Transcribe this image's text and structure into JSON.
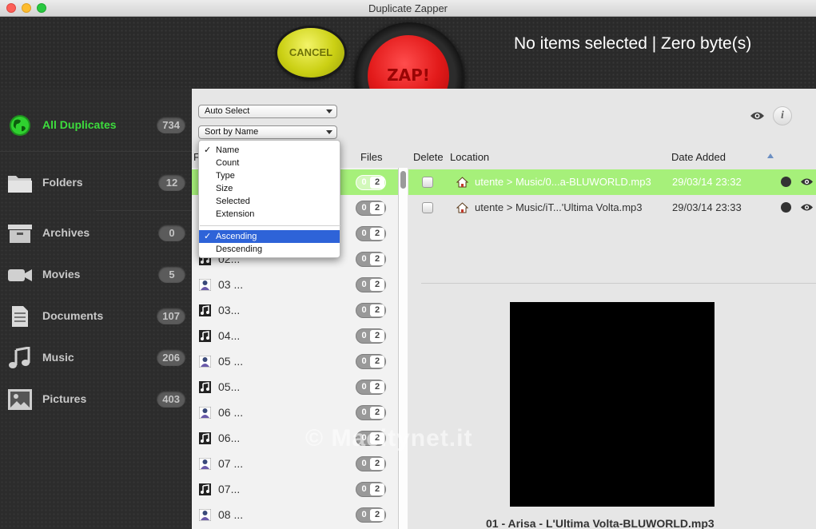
{
  "window": {
    "title": "Duplicate Zapper"
  },
  "toolbar": {
    "cancel_label": "CANCEL",
    "zap_label": "ZAP!",
    "status_text": "No items selected | Zero byte(s)"
  },
  "sidebar": {
    "items": [
      {
        "label": "All Duplicates",
        "count": "734",
        "icon": "globe-icon",
        "active": true
      },
      {
        "label": "Folders",
        "count": "12",
        "icon": "folder-icon"
      },
      {
        "label": "Archives",
        "count": "0",
        "icon": "archive-box-icon"
      },
      {
        "label": "Movies",
        "count": "5",
        "icon": "video-camera-icon"
      },
      {
        "label": "Documents",
        "count": "107",
        "icon": "document-icon"
      },
      {
        "label": "Music",
        "count": "206",
        "icon": "music-note-icon"
      },
      {
        "label": "Pictures",
        "count": "403",
        "icon": "picture-icon"
      }
    ]
  },
  "controls": {
    "auto_select": "Auto Select",
    "sort_by": "Sort by Name"
  },
  "sort_menu": {
    "fields": [
      "Name",
      "Count",
      "Type",
      "Size",
      "Selected",
      "Extension"
    ],
    "selected_field": "Name",
    "orders": [
      "Ascending",
      "Descending"
    ],
    "selected_order": "Ascending",
    "check_mark": "✓"
  },
  "columns": {
    "file_prefix": "F",
    "files": "Files",
    "delete": "Delete",
    "location": "Location",
    "date_added": "Date Added"
  },
  "file_list": {
    "rows": [
      {
        "name": "",
        "icon": "music-file-icon",
        "sel": "0",
        "total": "2",
        "selected": true
      },
      {
        "name": "",
        "icon": "music-file-icon",
        "sel": "0",
        "total": "2"
      },
      {
        "name": "",
        "icon": "music-file-icon",
        "sel": "0",
        "total": "2"
      },
      {
        "name": "02...",
        "icon": "music-file-icon",
        "sel": "0",
        "total": "2"
      },
      {
        "name": "03 ...",
        "icon": "person-file-icon",
        "sel": "0",
        "total": "2"
      },
      {
        "name": "03...",
        "icon": "music-file-icon",
        "sel": "0",
        "total": "2"
      },
      {
        "name": "04...",
        "icon": "music-file-icon",
        "sel": "0",
        "total": "2"
      },
      {
        "name": "05 ...",
        "icon": "person-file-icon",
        "sel": "0",
        "total": "2"
      },
      {
        "name": "05...",
        "icon": "music-file-icon",
        "sel": "0",
        "total": "2"
      },
      {
        "name": "06 ...",
        "icon": "person-file-icon",
        "sel": "0",
        "total": "2"
      },
      {
        "name": "06...",
        "icon": "music-file-icon",
        "sel": "0",
        "total": "2"
      },
      {
        "name": "07 ...",
        "icon": "person-file-icon",
        "sel": "0",
        "total": "2"
      },
      {
        "name": "07...",
        "icon": "music-file-icon",
        "sel": "0",
        "total": "2"
      },
      {
        "name": "08 ...",
        "icon": "person-file-icon",
        "sel": "0",
        "total": "2"
      }
    ]
  },
  "detail": {
    "rows": [
      {
        "location": "utente > Music/0...a-BLUWORLD.mp3",
        "date": "29/03/14 23:32",
        "selected": true
      },
      {
        "location": "utente > Music/iT...'Ultima Volta.mp3",
        "date": "29/03/14 23:33"
      }
    ],
    "caption": "01 - Arisa - L'Ultima Volta-BLUWORLD.mp3"
  },
  "info_label": "i",
  "watermark": "© Macitynet.it"
}
